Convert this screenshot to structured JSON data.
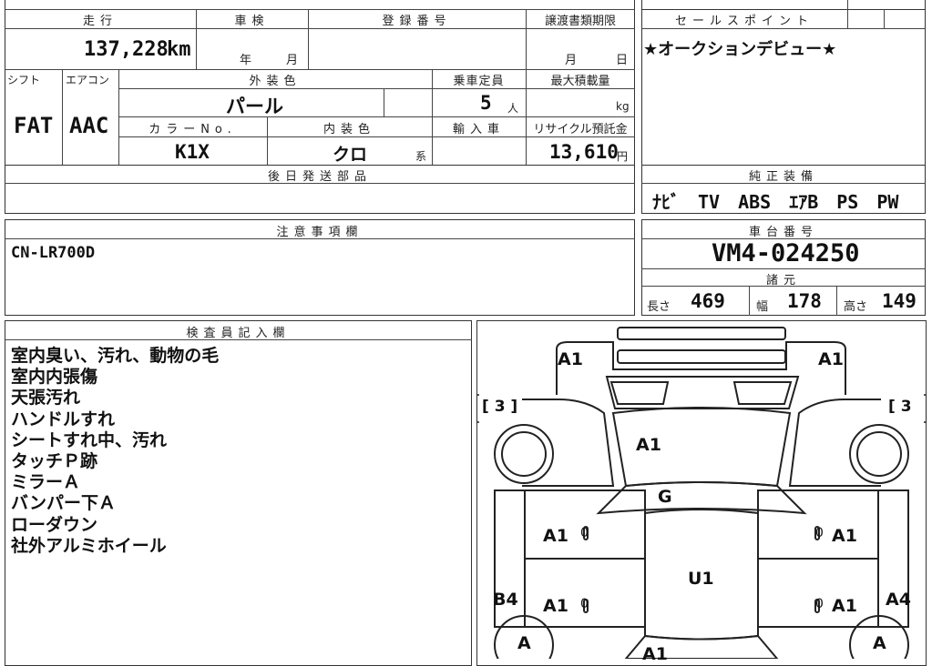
{
  "vehicle": {
    "mileage_label": "走行",
    "mileage_value": "137,228",
    "mileage_unit": "km",
    "inspection_label": "車検",
    "year_unit": "年",
    "month_unit": "月",
    "registration_label": "登録番号",
    "transfer_deadline_label": "譲渡書類期限",
    "transfer_month": "月",
    "transfer_day": "日",
    "shift_label": "シフト",
    "shift_value": "FAT",
    "aircon_label": "エアコン",
    "aircon_value": "AAC",
    "exterior_color_label": "外装色",
    "exterior_color_value": "パール",
    "capacity_label": "乗車定員",
    "capacity_value": "5",
    "capacity_unit": "人",
    "max_load_label": "最大積載量",
    "max_load_unit": "kg",
    "color_no_label": "カラーNo.",
    "color_no_value": "K1X",
    "interior_color_label": "内装色",
    "interior_color_value": "クロ",
    "interior_color_suffix": "系",
    "import_label": "輸入車",
    "recycle_label": "リサイクル預託金",
    "recycle_value": "13,610",
    "recycle_unit": "円",
    "later_parts_label": "後日発送部品"
  },
  "sales_point": {
    "label": "セールスポイント",
    "text": "★オークションデビュー★"
  },
  "equipment": {
    "label": "純正装備",
    "text": "ﾅﾋﾞ　TV　ABS　ｴｱB　PS　PW"
  },
  "notes": {
    "label": "注意事項欄",
    "text": "CN-LR700D"
  },
  "chassis": {
    "label": "車台番号",
    "value": "VM4-024250",
    "specs_label": "諸元",
    "length_label": "長さ",
    "length_value": "469",
    "width_label": "幅",
    "width_value": "178",
    "height_label": "高さ",
    "height_value": "149"
  },
  "inspector": {
    "label": "検査員記入欄",
    "lines": [
      "室内臭い、汚れ、動物の毛",
      "室内内張傷",
      "天張汚れ",
      "ハンドルすれ",
      "シートすれ中、汚れ",
      "タッチＰ跡",
      "ミラーＡ",
      "バンパー下Ａ",
      "ローダウン",
      "社外アルミホイール"
    ]
  },
  "diagram_marks": {
    "front_left": "A1",
    "front_right": "A1",
    "bracket_left": "[ 3 ]",
    "bracket_right": "[ 3",
    "hood": "A1",
    "windshield": "G",
    "left_front_door": "A1",
    "right_front_door": "A1",
    "roof": "U1",
    "left_rear_door": "A1",
    "right_rear_door": "A1",
    "left_rocker": "B4",
    "right_rocker": "A4",
    "left_rear_wheel": "A",
    "right_rear_wheel": "A",
    "rear_partial": "A1",
    "zero_mark": "0"
  }
}
